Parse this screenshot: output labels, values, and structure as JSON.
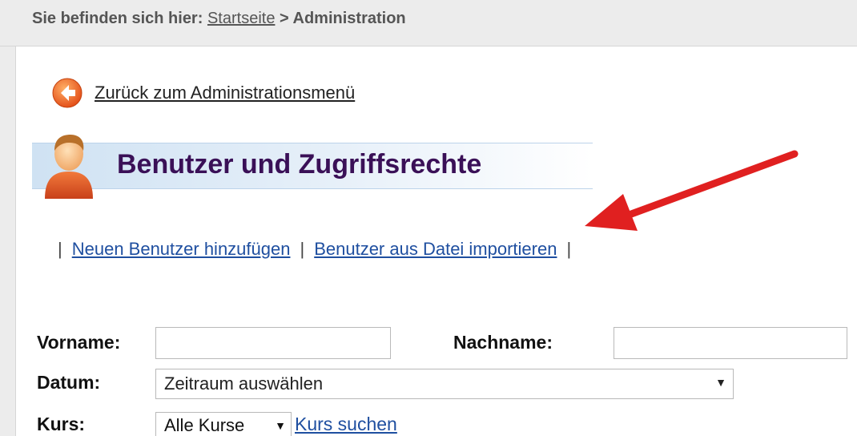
{
  "breadcrumb": {
    "prefix": "Sie befinden sich hier:",
    "home_link": "Startseite",
    "separator": ">",
    "current": "Administration"
  },
  "back_link": {
    "label": "Zurück zum Administrationsmenü",
    "icon": "back-arrow-icon"
  },
  "page": {
    "title": "Benutzer und Zugriffsrechte",
    "icon": "user-icon"
  },
  "actions": {
    "separator": "|",
    "add_user": "Neuen Benutzer hinzufügen",
    "import_users": "Benutzer aus Datei importieren"
  },
  "form": {
    "vorname_label": "Vorname:",
    "vorname_value": "",
    "nachname_label": "Nachname:",
    "nachname_value": "",
    "datum_label": "Datum:",
    "datum_selected": "Zeitraum auswählen",
    "kurs_label": "Kurs:",
    "kurs_selected": "Alle Kurse",
    "kurs_search_link": "Kurs suchen"
  },
  "colors": {
    "title": "#3a1057",
    "link": "#1f4fa0",
    "annotation_arrow": "#e02020",
    "back_icon": "#f26522"
  }
}
